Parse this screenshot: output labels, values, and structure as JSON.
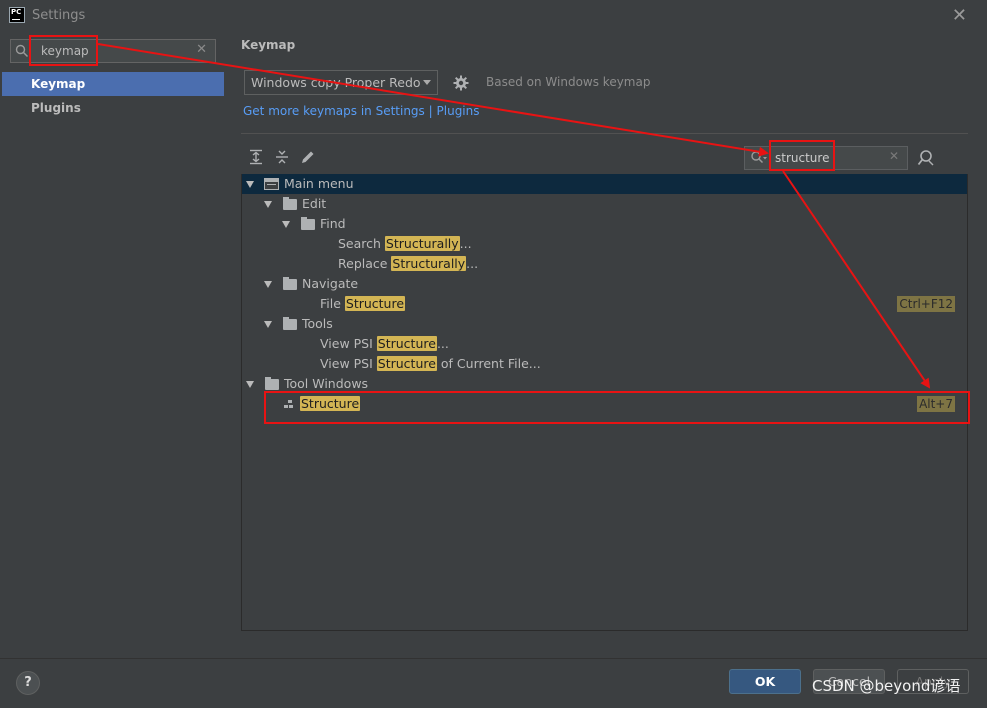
{
  "window": {
    "title": "Settings",
    "app_icon_text": "PC"
  },
  "sidebar": {
    "search_value": "keymap",
    "items": [
      {
        "label": "Keymap",
        "active": true
      },
      {
        "label": "Plugins",
        "active": false
      }
    ]
  },
  "keymap": {
    "section_title": "Keymap",
    "scheme": "Windows copy Proper Redo",
    "based_on": "Based on Windows keymap",
    "link_text": "Get more keymaps in Settings",
    "link_sep": "|",
    "link_plugins": "Plugins",
    "filter_value": "structure"
  },
  "tree": {
    "rows": [
      {
        "pre": "",
        "hl": "",
        "post": "Main menu",
        "shortcut": ""
      },
      {
        "pre": "",
        "hl": "",
        "post": "Edit",
        "shortcut": ""
      },
      {
        "pre": "",
        "hl": "",
        "post": "Find",
        "shortcut": ""
      },
      {
        "pre": "Search ",
        "hl": "Structurally",
        "post": "...",
        "shortcut": ""
      },
      {
        "pre": "Replace ",
        "hl": "Structurally",
        "post": "...",
        "shortcut": ""
      },
      {
        "pre": "",
        "hl": "",
        "post": "Navigate",
        "shortcut": ""
      },
      {
        "pre": "File ",
        "hl": "Structure",
        "post": "",
        "shortcut": "Ctrl+F12"
      },
      {
        "pre": "",
        "hl": "",
        "post": "Tools",
        "shortcut": ""
      },
      {
        "pre": "View PSI ",
        "hl": "Structure",
        "post": "...",
        "shortcut": ""
      },
      {
        "pre": "View PSI ",
        "hl": "Structure",
        "post": " of Current File...",
        "shortcut": ""
      },
      {
        "pre": "",
        "hl": "",
        "post": "Tool Windows",
        "shortcut": ""
      },
      {
        "pre": "",
        "hl": "Structure",
        "post": "",
        "shortcut": "Alt+7"
      }
    ]
  },
  "footer": {
    "help": "?",
    "ok": "OK",
    "cancel": "Cancel",
    "apply": "Apply",
    "watermark": "CSDN @beyond谚语"
  },
  "colors": {
    "accent": "#4b6eaf",
    "highlight": "#d3b554",
    "annotation": "#e81313"
  }
}
